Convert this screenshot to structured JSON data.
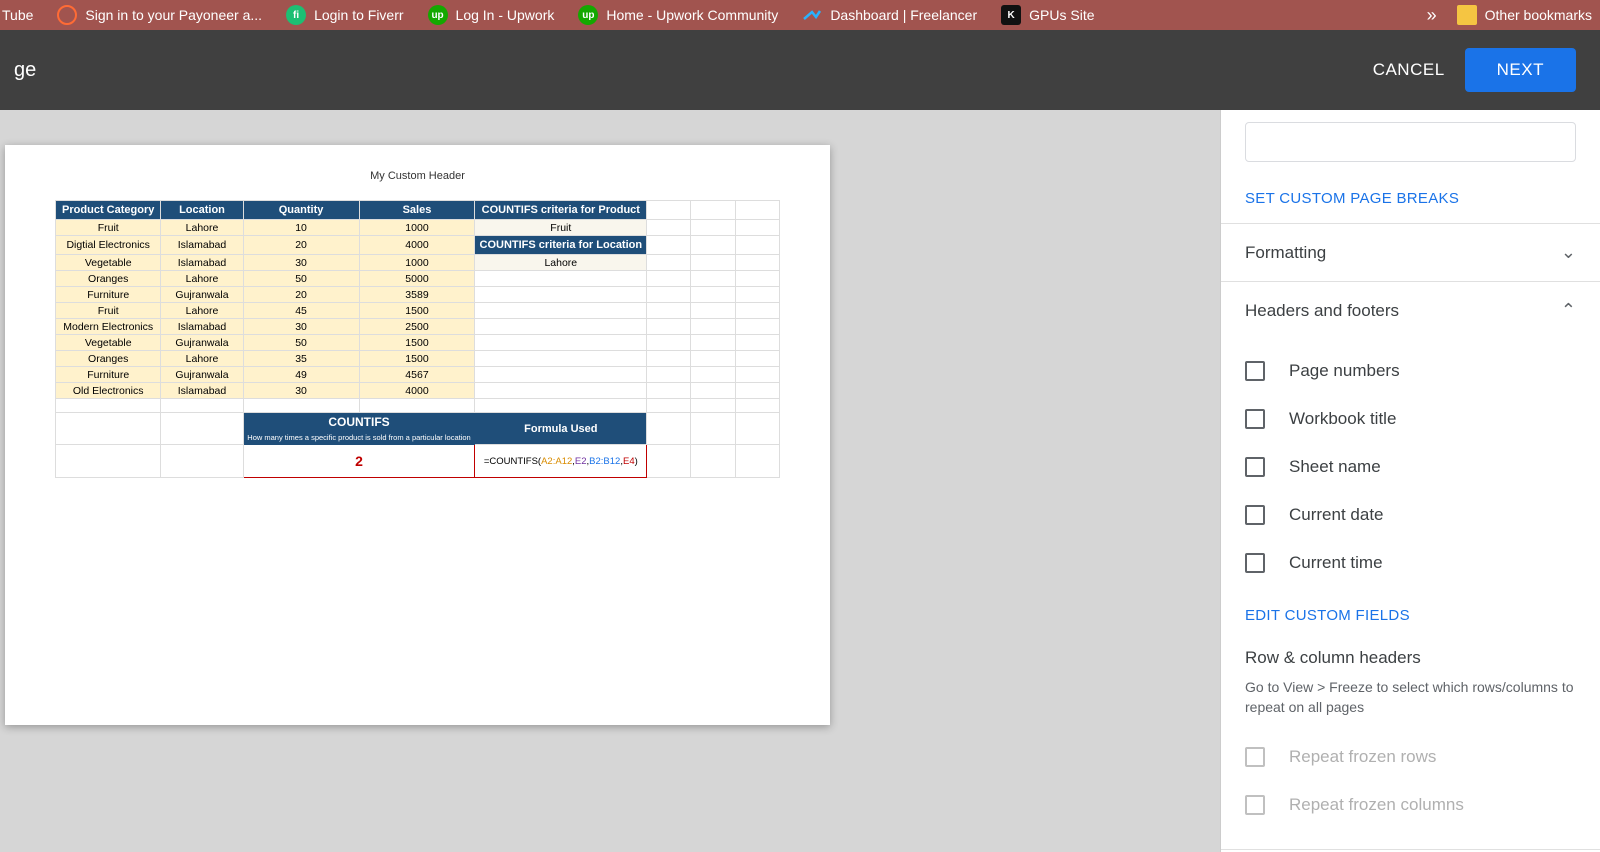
{
  "bookmarks": {
    "items": [
      {
        "label": "Tube"
      },
      {
        "label": "Sign in to your Payoneer a..."
      },
      {
        "label": "Login to Fiverr"
      },
      {
        "label": "Log In - Upwork"
      },
      {
        "label": "Home - Upwork Community"
      },
      {
        "label": "Dashboard | Freelancer"
      },
      {
        "label": "GPUs Site"
      }
    ],
    "overflow": "»",
    "other": "Other bookmarks"
  },
  "toolbar": {
    "title_suffix": "ge",
    "cancel": "CANCEL",
    "next": "NEXT"
  },
  "preview": {
    "header": "My Custom Header",
    "columns": [
      "Product Category",
      "Location",
      "Quantity",
      "Sales",
      "COUNTIFS criteria for Product"
    ],
    "criteria_product": "Fruit",
    "criteria_location_hdr": "COUNTIFS criteria for Location",
    "criteria_location": "Lahore",
    "rows": [
      [
        "Fruit",
        "Lahore",
        "10",
        "1000"
      ],
      [
        "Digtial Electronics",
        "Islamabad",
        "20",
        "4000"
      ],
      [
        "Vegetable",
        "Islamabad",
        "30",
        "1000"
      ],
      [
        "Oranges",
        "Lahore",
        "50",
        "5000"
      ],
      [
        "Furniture",
        "Gujranwala",
        "20",
        "3589"
      ],
      [
        "Fruit",
        "Lahore",
        "45",
        "1500"
      ],
      [
        "Modern Electronics",
        "Islamabad",
        "30",
        "2500"
      ],
      [
        "Vegetable",
        "Gujranwala",
        "50",
        "1500"
      ],
      [
        "Oranges",
        "Lahore",
        "35",
        "1500"
      ],
      [
        "Furniture",
        "Gujranwala",
        "49",
        "4567"
      ],
      [
        "Old Electronics",
        "Islamabad",
        "30",
        "4000"
      ]
    ],
    "countifs": {
      "title": "COUNTIFS",
      "subtitle": "How many times a specific product is sold from a particular location",
      "formula_hdr": "Formula Used",
      "result": "2",
      "formula_prefix": "=COUNTIFS(",
      "formula_r1": "A2:A12",
      "formula_r2": "E2",
      "formula_r3": "B2:B12",
      "formula_r4": "E4",
      "formula_suffix": ")"
    }
  },
  "panel": {
    "page_breaks": "SET CUSTOM PAGE BREAKS",
    "formatting": "Formatting",
    "headers_footers": "Headers and footers",
    "checkboxes": [
      "Page numbers",
      "Workbook title",
      "Sheet name",
      "Current date",
      "Current time"
    ],
    "edit_custom": "EDIT CUSTOM FIELDS",
    "row_col_title": "Row & column headers",
    "row_col_desc": "Go to View > Freeze to select which rows/columns to repeat on all pages",
    "repeat_rows": "Repeat frozen rows",
    "repeat_cols": "Repeat frozen columns"
  }
}
